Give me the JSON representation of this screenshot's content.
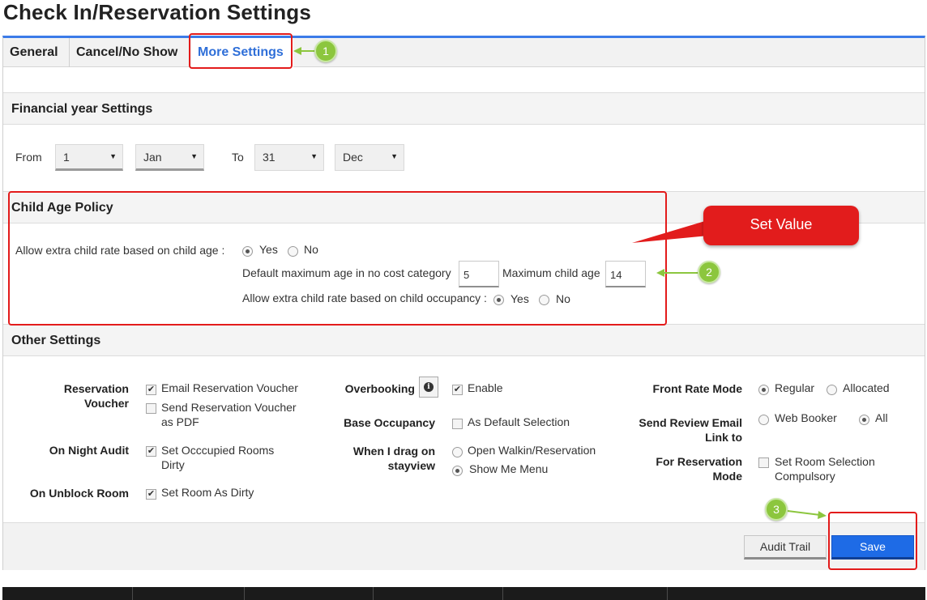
{
  "page": {
    "title": "Check In/Reservation Settings"
  },
  "tabs": [
    "General",
    "Cancel/No Show",
    "More Settings"
  ],
  "financial": {
    "heading": "Financial year Settings",
    "from_label": "From",
    "to_label": "To",
    "from_day": "1",
    "from_month": "Jan",
    "to_day": "31",
    "to_month": "Dec"
  },
  "child_age": {
    "heading": "Child Age Policy",
    "rate_label": "Allow extra child rate based on child age :",
    "yes": "Yes",
    "no": "No",
    "rate_selected": "Yes",
    "default_max_label": "Default maximum age in no cost category",
    "default_max_value": "5",
    "max_child_label": "Maximum child age",
    "max_child_value": "14",
    "occupancy_label": "Allow extra child rate based on child occupancy :",
    "occupancy_selected": "Yes"
  },
  "other": {
    "heading": "Other Settings",
    "reservation_voucher_label": "Reservation Voucher",
    "email_voucher": "Email Reservation Voucher",
    "send_pdf": "Send Reservation Voucher as PDF",
    "night_audit_label": "On Night Audit",
    "set_dirty": "Set Occcupied Rooms Dirty",
    "unblock_label": "On Unblock Room",
    "set_room_dirty": "Set Room As Dirty",
    "overbooking_label": "Overbooking",
    "enable": "Enable",
    "base_occupancy_label": "Base Occupancy",
    "as_default": "As Default Selection",
    "drag_label": "When I drag on stayview",
    "open_walkin": "Open Walkin/Reservation",
    "show_menu": "Show Me Menu",
    "front_rate_label": "Front Rate Mode",
    "regular": "Regular",
    "allocated": "Allocated",
    "review_email_label": "Send Review Email Link to",
    "web_booker": "Web Booker",
    "all": "All",
    "reservation_mode_label": "For Reservation Mode",
    "set_room_selection": "Set Room Selection Compulsory"
  },
  "buttons": {
    "audit_trail": "Audit Trail",
    "save": "Save"
  },
  "annotations": {
    "step1": "1",
    "step2": "2",
    "step3": "3",
    "set_value": "Set Value"
  },
  "colors": {
    "accent": "#3b7be8",
    "save_button": "#1e6be6",
    "annotation_red": "#e21c1c",
    "annotation_green": "#8cc63e"
  }
}
